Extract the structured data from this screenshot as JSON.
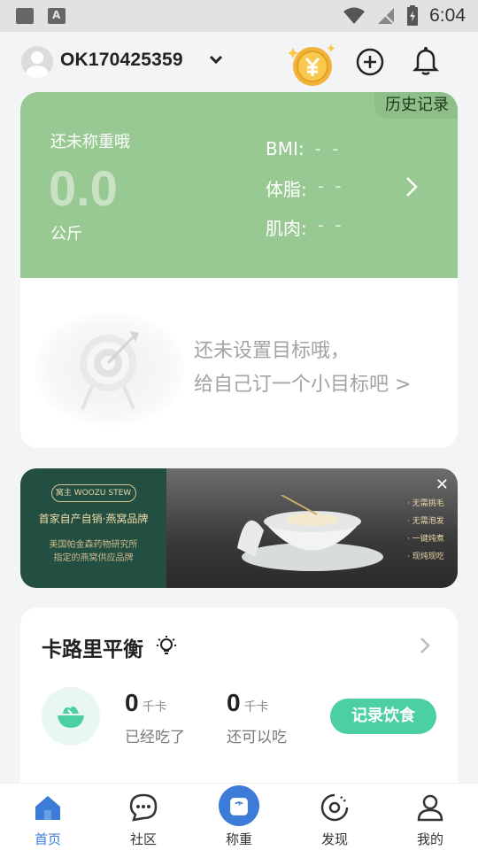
{
  "status_bar": {
    "time": "6:04"
  },
  "header": {
    "username": "OK170425359"
  },
  "weight_card": {
    "history_label": "历史记录",
    "hint": "还未称重哦",
    "weight_value": "0.0",
    "weight_unit": "公斤",
    "metrics": [
      {
        "label": "BMI:",
        "value": "- -"
      },
      {
        "label": "体脂:",
        "value": "- -"
      },
      {
        "label": "肌肉:",
        "value": "- -"
      }
    ],
    "goal_line1": "还未设置目标哦，",
    "goal_line2": "给自己订一个小目标吧 >"
  },
  "banner": {
    "brand_tag": "窝主 WOOZU STEW",
    "slogan": "首家自产自销·燕窝品牌",
    "desc_line1": "美国帕金森药物研究所",
    "desc_line2": "指定的燕窝供应品牌",
    "features": [
      "· 无需挑毛",
      "· 无需泡发",
      "· 一键炖煮",
      "· 现炖现吃"
    ]
  },
  "calorie_card": {
    "title": "卡路里平衡",
    "eaten": {
      "value": "0",
      "unit": "千卡",
      "label": "已经吃了"
    },
    "remaining": {
      "value": "0",
      "unit": "千卡",
      "label": "还可以吃"
    },
    "record_button": "记录饮食"
  },
  "tabbar": {
    "items": [
      {
        "label": "首页",
        "icon": "home-icon"
      },
      {
        "label": "社区",
        "icon": "chat-bubble-icon"
      },
      {
        "label": "称重",
        "icon": "scale-icon"
      },
      {
        "label": "发现",
        "icon": "discover-icon"
      },
      {
        "label": "我的",
        "icon": "person-icon"
      }
    ],
    "active_color": "#3d7bd8"
  },
  "colors": {
    "weight_green": "#99c992",
    "accent_teal": "#4dcfa6",
    "tab_blue": "#3d7bd8"
  }
}
